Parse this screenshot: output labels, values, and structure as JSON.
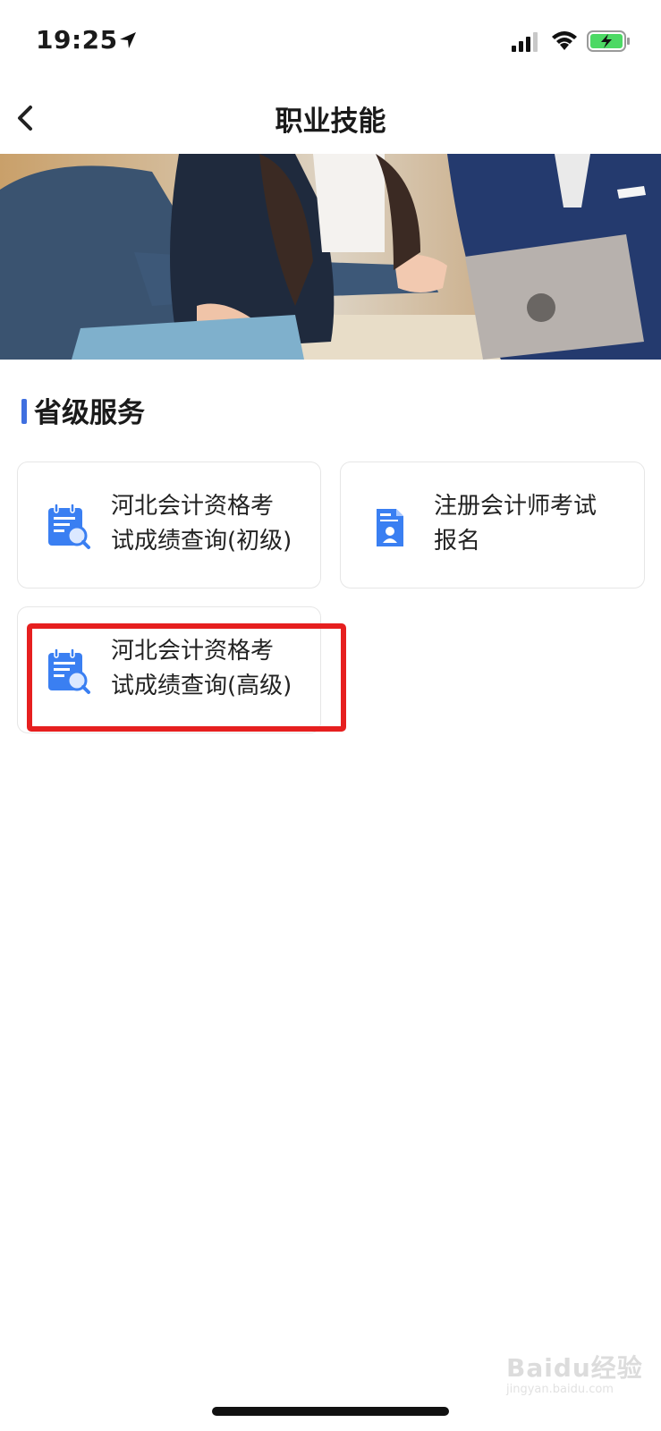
{
  "status_bar": {
    "time": "19:25"
  },
  "nav": {
    "title": "职业技能"
  },
  "section": {
    "title": "省级服务"
  },
  "services": [
    {
      "label_line1": "河北会计资格考",
      "label_line2": "试成绩查询(初级)",
      "icon": "exam-score-query-icon"
    },
    {
      "label_line1": "注册会计师考试",
      "label_line2": "报名",
      "icon": "cpa-registration-icon"
    },
    {
      "label_line1": "河北会计资格考",
      "label_line2": "试成绩查询(高级)",
      "icon": "exam-score-query-icon"
    }
  ],
  "watermark": {
    "brand": "Baidu经验",
    "url": "jingyan.baidu.com"
  },
  "colors": {
    "accent": "#3f6fe0",
    "highlight": "#e61f1f",
    "icon_blue": "#3a7ff2"
  }
}
